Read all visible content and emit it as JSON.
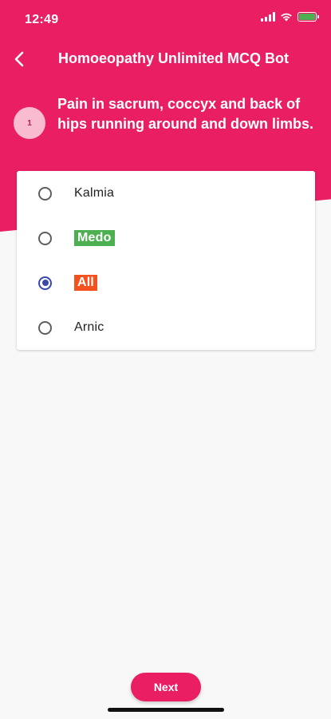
{
  "status_bar": {
    "time": "12:49",
    "battery_color": "#4caf50"
  },
  "app_bar": {
    "back_icon": "chevron-left-icon",
    "title": "Homoeopathy Unlimited MCQ Bot"
  },
  "question": {
    "number": "1",
    "text": "Pain in sacrum, coccyx and back of hips running around and down limbs."
  },
  "options": [
    {
      "label": "Kalmia",
      "selected": false,
      "state": "normal"
    },
    {
      "label": "Medo",
      "selected": false,
      "state": "correct"
    },
    {
      "label": "All",
      "selected": true,
      "state": "wrong"
    },
    {
      "label": "Arnic",
      "selected": false,
      "state": "normal"
    }
  ],
  "next_button": {
    "label": "Next"
  },
  "colors": {
    "primary": "#e91e63",
    "correct": "#4caf50",
    "wrong": "#f4511e",
    "radio_selected": "#3949ab"
  }
}
